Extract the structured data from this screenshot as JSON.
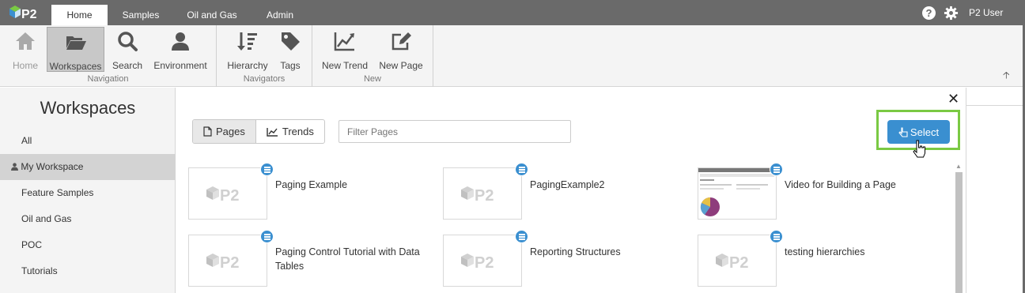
{
  "app": {
    "user_name": "P2 User"
  },
  "tabs": [
    {
      "label": "Home"
    },
    {
      "label": "Samples"
    },
    {
      "label": "Oil and Gas"
    },
    {
      "label": "Admin"
    }
  ],
  "ribbon": {
    "navigation": {
      "group_label": "Navigation",
      "home": "Home",
      "workspaces": "Workspaces",
      "search": "Search",
      "environment": "Environment"
    },
    "navigators": {
      "group_label": "Navigators",
      "hierarchy": "Hierarchy",
      "tags": "Tags"
    },
    "new": {
      "group_label": "New",
      "new_trend": "New Trend",
      "new_page": "New Page"
    }
  },
  "sidebar": {
    "title": "Workspaces",
    "items": [
      {
        "label": "All"
      },
      {
        "label": "My Workspace"
      },
      {
        "label": "Feature Samples"
      },
      {
        "label": "Oil and Gas"
      },
      {
        "label": "POC"
      },
      {
        "label": "Tutorials"
      }
    ]
  },
  "main": {
    "pages_label": "Pages",
    "trends_label": "Trends",
    "filter_placeholder": "Filter Pages",
    "select_label": "Select",
    "items": [
      {
        "title": "Paging Example"
      },
      {
        "title": "PagingExample2"
      },
      {
        "title": "Video for Building a Page"
      },
      {
        "title": "Paging Control Tutorial with Data Tables"
      },
      {
        "title": "Reporting Structures"
      },
      {
        "title": "testing hierarchies"
      }
    ]
  },
  "colors": {
    "accent": "#3a8fd0",
    "highlight": "#7ac943",
    "topbar": "#6a6a6a"
  }
}
